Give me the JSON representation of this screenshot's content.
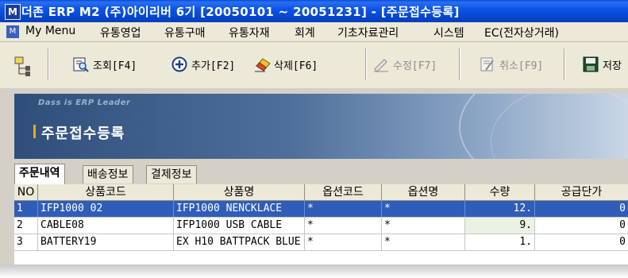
{
  "window": {
    "icon_label": "M",
    "title": "더존 ERP M2 (주)아이리버 6기 [20050101 ~ 20051231] - [주문접수등록]"
  },
  "menu": {
    "icon_label": "M",
    "items": [
      "My Menu",
      "유통영업",
      "유통구매",
      "유통자재",
      "회계",
      "기초자료관리",
      "시스템",
      "EC(전자상거래)"
    ]
  },
  "toolbar": {
    "buttons": [
      {
        "label": "조회[F4]",
        "icon": "search-document-icon",
        "enabled": true
      },
      {
        "label": "추가[F2]",
        "icon": "add-circle-icon",
        "enabled": true
      },
      {
        "label": "삭제[F6]",
        "icon": "eraser-delete-icon",
        "enabled": true
      },
      {
        "label": "수정[F7]",
        "icon": "edit-pencil-icon",
        "enabled": false
      },
      {
        "label": "취소[F9]",
        "icon": "cancel-document-icon",
        "enabled": false
      },
      {
        "label": "저장",
        "icon": "save-disk-icon",
        "enabled": true
      }
    ]
  },
  "banner": {
    "slogan": "Dass is ERP Leader",
    "title": "주문접수등록"
  },
  "tabs": [
    "주문내역",
    "배송정보",
    "결제정보"
  ],
  "grid": {
    "columns": [
      "NO",
      "상품코드",
      "상품명",
      "옵션코드",
      "옵션명",
      "수량",
      "공급단가"
    ],
    "rows": [
      {
        "no": "1",
        "code": "IFP1000 02",
        "name": "IFP1000 NENCKLACE",
        "opt_code": "*",
        "opt_name": "*",
        "qty": "12.",
        "price": "0",
        "selected": true
      },
      {
        "no": "2",
        "code": "CABLE08",
        "name": "IFP1000 USB CABLE",
        "opt_code": "*",
        "opt_name": "*",
        "qty": "9.",
        "price": "0",
        "selected": false
      },
      {
        "no": "3",
        "code": "BATTERY19",
        "name": "EX H10 BATTPACK BLUE",
        "opt_code": "*",
        "opt_name": "*",
        "qty": "1.",
        "price": "0",
        "selected": false
      }
    ]
  },
  "colors": {
    "title_bar": "#0b55e8",
    "selected_row": "#2f5db8",
    "banner_accent": "#f4a41c"
  }
}
